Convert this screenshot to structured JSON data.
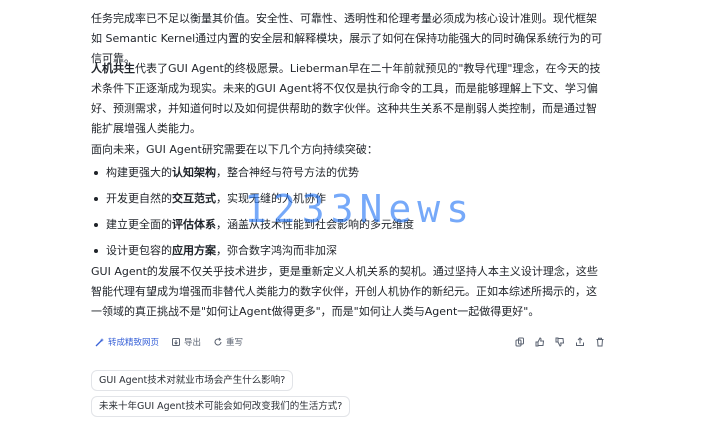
{
  "paragraphs": {
    "p1": "任务完成率已不足以衡量其价值。安全性、可靠性、透明性和伦理考量必须成为核心设计准则。现代框架如 Semantic Kernel通过内置的安全层和解释模块，展示了如何在保持功能强大的同时确保系统行为的可信可靠。",
    "p2_bold": "人机共生",
    "p2_rest": "代表了GUI Agent的终极愿景。Lieberman早在二十年前就预见的\"教导代理\"理念，在今天的技术条件下正逐渐成为现实。未来的GUI Agent将不仅仅是执行命令的工具，而是能够理解上下文、学习偏好、预测需求，并知道何时以及如何提供帮助的数字伙伴。这种共生关系不是削弱人类控制，而是通过智能扩展增强人类能力。",
    "p3": "面向未来，GUI Agent研究需要在以下几个方向持续突破：",
    "p4": "GUI Agent的发展不仅关乎技术进步，更是重新定义人机关系的契机。通过坚持人本主义设计理念，这些智能代理有望成为增强而非替代人类能力的数字伙伴，开创人机协作的新纪元。正如本综述所揭示的，这一领域的真正挑战不是\"如何让Agent做得更多\"，而是\"如何让人类与Agent一起做得更好\"。"
  },
  "bullets": [
    {
      "pre": "构建更强大的",
      "bold": "认知架构",
      "post": "，整合神经与符号方法的优势"
    },
    {
      "pre": "开发更自然的",
      "bold": "交互范式",
      "post": "，实现无缝的人机协作"
    },
    {
      "pre": "建立更全面的",
      "bold": "评估体系",
      "post": "，涵盖从技术性能到社会影响的多元维度"
    },
    {
      "pre": "设计更包容的",
      "bold": "应用方案",
      "post": "，弥合数字鸿沟而非加深"
    }
  ],
  "actions": {
    "web": "转成精致网页",
    "export": "导出",
    "rewrite": "重写"
  },
  "icons": [
    "copy-icon",
    "thumbs-up-icon",
    "thumbs-down-icon",
    "share-icon",
    "trash-icon"
  ],
  "suggestions": [
    "GUI Agent技术对就业市场会产生什么影响?",
    "未来十年GUI Agent技术可能会如何改变我们的生活方式?"
  ],
  "watermark": "1233News",
  "colors": {
    "accent": "#3a63d8",
    "watermark": "#2e7cf6",
    "text": "#1f2329"
  }
}
